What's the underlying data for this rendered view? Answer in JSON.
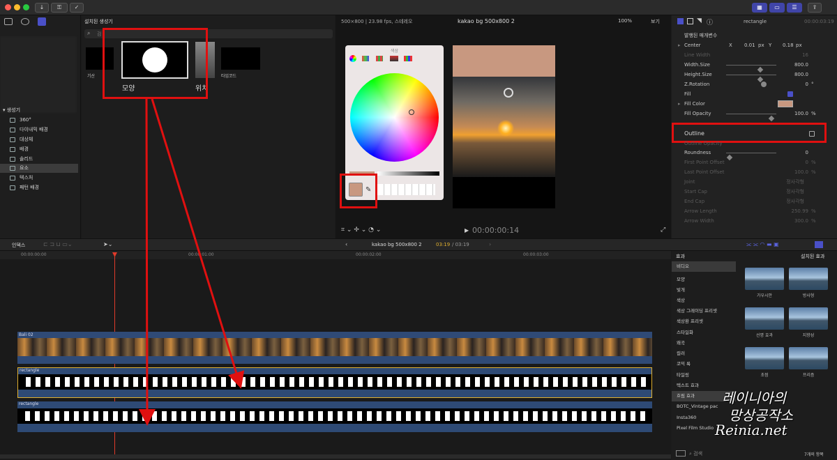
{
  "toolbar": {
    "import_icon": "download-icon",
    "keys_icon": "key-icon",
    "check_icon": "check-icon"
  },
  "browser": {
    "header": "설치된 생성기",
    "search_placeholder": "검",
    "items": [
      {
        "label": "기산"
      },
      {
        "label": "모양"
      },
      {
        "label": "위치"
      },
      {
        "label": "타임코드"
      }
    ]
  },
  "library": {
    "section_label": "생성기",
    "items": [
      {
        "label": "360°"
      },
      {
        "label": "다이내믹 배경"
      },
      {
        "label": "대상체"
      },
      {
        "label": "배경"
      },
      {
        "label": "솔리드"
      },
      {
        "label": "요소"
      },
      {
        "label": "텍스처"
      },
      {
        "label": "패턴 배경"
      }
    ]
  },
  "viewer": {
    "format": "500×800 | 23.98 fps, 스테레오",
    "project": "kakao bg 500x800 2",
    "zoom": "100%",
    "view_menu": "보기",
    "timecode": "00:00:00:14"
  },
  "color_picker": {
    "title": "색상",
    "selected_color": "#c89880"
  },
  "inspector": {
    "title": "rectangle",
    "duration": "00:00:03:19",
    "section": "발행된 매개변수",
    "rows": [
      {
        "label": "Center",
        "x_label": "X",
        "x_val": "0.01",
        "x_unit": "px",
        "y_label": "Y",
        "y_val": "0.18",
        "y_unit": "px"
      },
      {
        "label": "Line Width",
        "val": "16"
      },
      {
        "label": "Width.Size",
        "val": "800.0"
      },
      {
        "label": "Height.Size",
        "val": "800.0"
      },
      {
        "label": "Z.Rotation",
        "val": "0",
        "unit": "°"
      },
      {
        "label": "Fill"
      },
      {
        "label": "Fill Color"
      },
      {
        "label": "Fill Opacity",
        "val": "100.0",
        "unit": "%"
      },
      {
        "label": "Outline"
      },
      {
        "label": "Outline Opacity"
      },
      {
        "label": "Roundness",
        "val": "0"
      },
      {
        "label": "First Point Offset",
        "val": "0",
        "unit": "%"
      },
      {
        "label": "Last Point Offset",
        "val": "100.0",
        "unit": "%"
      },
      {
        "label": "Joint",
        "val": "정사각형"
      },
      {
        "label": "Start Cap",
        "val": "정사각형"
      },
      {
        "label": "End Cap",
        "val": "정사각형"
      },
      {
        "label": "Arrow Length",
        "val": "250.99",
        "unit": "%"
      },
      {
        "label": "Arrow Width",
        "val": "300.0",
        "unit": "%"
      }
    ]
  },
  "timeline": {
    "index_label": "인덱스",
    "project": "kakao bg 500x800 2",
    "time_current": "03:19",
    "time_total": "/ 03:19",
    "ruler": [
      "00:00:00:00",
      "00:00:01:00",
      "00:00:02:00",
      "00:00:03:00"
    ],
    "clips": [
      {
        "name": "Bali 02"
      },
      {
        "name": "rectangle"
      },
      {
        "name": "rectangle"
      }
    ]
  },
  "effects": {
    "header_label": "효과",
    "installed_label": "설치된 효과",
    "categories": [
      "비디오",
      "모양",
      "빛개",
      "색상",
      "색상 그레이딩 프리셋",
      "색상환 프리셋",
      "스타일화",
      "왜곡",
      "컬러",
      "코믹 룩",
      "타일링",
      "텍스트 효과",
      "흐림 효과",
      "BOTC_Vintage pac",
      "Insta360",
      "Pixel Film Studio"
    ],
    "thumbs": [
      "가우시안",
      "방사형",
      "선명 효과",
      "지향성",
      "초점",
      "프리즘"
    ],
    "search_placeholder": "검색",
    "count": "7개의 항목"
  },
  "watermark": {
    "line1": "레이니아의",
    "line2": "망상공작소",
    "line3": "Reinia.net"
  }
}
